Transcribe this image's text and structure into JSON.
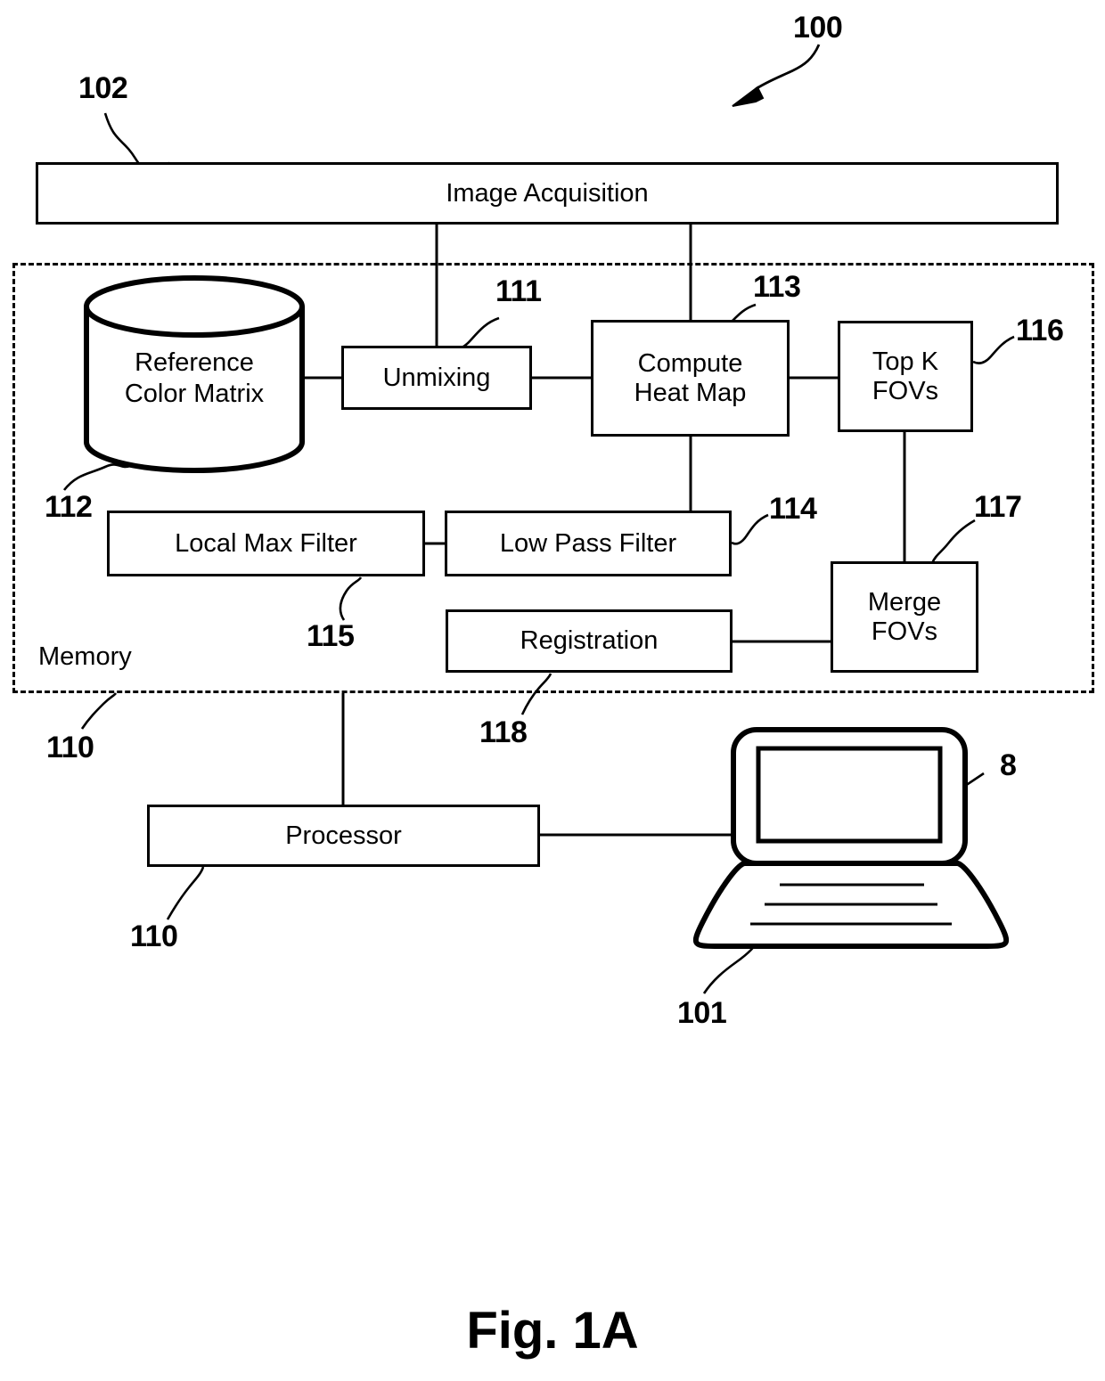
{
  "figure": {
    "caption": "Fig. 1A",
    "system_ref": "100"
  },
  "nodes": {
    "image_acquisition": {
      "label": "Image Acquisition",
      "ref": "102"
    },
    "reference_color_matrix": {
      "label": "Reference\nColor Matrix",
      "ref": "112"
    },
    "unmixing": {
      "label": "Unmixing",
      "ref": "111"
    },
    "compute_heat_map": {
      "label": "Compute\nHeat Map",
      "ref": "113"
    },
    "top_k_fovs": {
      "label": "Top K\nFOVs",
      "ref": "116"
    },
    "local_max_filter": {
      "label": "Local Max Filter",
      "ref": "115"
    },
    "low_pass_filter": {
      "label": "Low Pass Filter",
      "ref": "114"
    },
    "registration": {
      "label": "Registration",
      "ref": "118"
    },
    "merge_fovs": {
      "label": "Merge\nFOVs",
      "ref": "117"
    },
    "processor": {
      "label": "Processor",
      "ref": "110"
    },
    "memory": {
      "label": "Memory",
      "ref": "110"
    },
    "computer": {
      "ref": "101"
    },
    "display": {
      "ref": "8"
    }
  },
  "refs": {
    "r100": "100",
    "r101": "101",
    "r102": "102",
    "r110a": "110",
    "r110b": "110",
    "r111": "111",
    "r112": "112",
    "r113": "113",
    "r114": "114",
    "r115": "115",
    "r116": "116",
    "r117": "117",
    "r118": "118",
    "r8": "8"
  },
  "colors": {
    "stroke": "#000000",
    "background": "#ffffff"
  }
}
